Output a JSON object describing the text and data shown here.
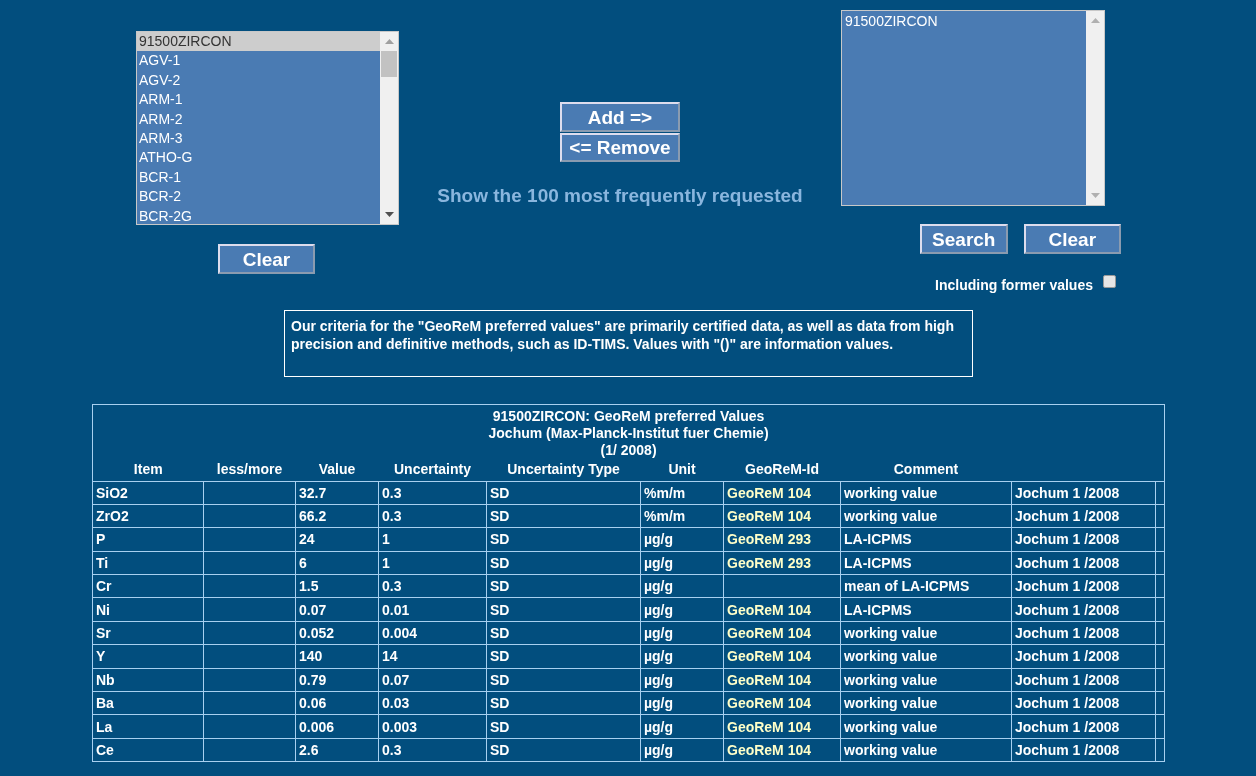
{
  "available_list": {
    "items": [
      {
        "label": "91500ZIRCON",
        "selected": true
      },
      {
        "label": "AGV-1",
        "selected": false
      },
      {
        "label": "AGV-2",
        "selected": false
      },
      {
        "label": "ARM-1",
        "selected": false
      },
      {
        "label": "ARM-2",
        "selected": false
      },
      {
        "label": "ARM-3",
        "selected": false
      },
      {
        "label": "ATHO-G",
        "selected": false
      },
      {
        "label": "BCR-1",
        "selected": false
      },
      {
        "label": "BCR-2",
        "selected": false
      },
      {
        "label": "BCR-2G",
        "selected": false
      }
    ],
    "clear_button": "Clear"
  },
  "transfer_buttons": {
    "add": "Add =>",
    "remove": "<= Remove"
  },
  "frequent_link": "Show the 100 most frequently requested",
  "chosen_list": {
    "items": [
      {
        "label": "91500ZIRCON"
      }
    ],
    "search_button": "Search",
    "clear_button": "Clear"
  },
  "former_values": {
    "label": "Including former values",
    "checked": false
  },
  "note": "Our criteria for the \"GeoReM preferred values\" are primarily certified data, as well as data from high precision and definitive methods, such as ID-TIMS. Values with \"()\" are information values.",
  "table": {
    "title_lines": [
      "91500ZIRCON: GeoReM preferred Values",
      "Jochum (Max-Planck-Institut fuer Chemie)",
      "(1/ 2008)"
    ],
    "columns": [
      "Item",
      "less/more",
      "Value",
      "Uncertainty",
      "Uncertainty Type",
      "Unit",
      "GeoReM-Id",
      "Comment"
    ],
    "rows": [
      [
        "SiO2",
        null,
        "32.7",
        "0.3",
        "SD",
        "%m/m",
        "GeoReM 104",
        "working value",
        "Jochum 1 /2008"
      ],
      [
        "ZrO2",
        null,
        "66.2",
        "0.3",
        "SD",
        "%m/m",
        "GeoReM 104",
        "working value",
        "Jochum 1 /2008"
      ],
      [
        "P",
        null,
        "24",
        "1",
        "SD",
        "µg/g",
        "GeoReM 293",
        "LA-ICPMS",
        "Jochum 1 /2008"
      ],
      [
        "Ti",
        null,
        "6",
        "1",
        "SD",
        "µg/g",
        "GeoReM 293",
        "LA-ICPMS",
        "Jochum 1 /2008"
      ],
      [
        "Cr",
        null,
        "1.5",
        "0.3",
        "SD",
        "µg/g",
        null,
        "mean of LA-ICPMS",
        "Jochum 1 /2008"
      ],
      [
        "Ni",
        null,
        "0.07",
        "0.01",
        "SD",
        "µg/g",
        "GeoReM 104",
        "LA-ICPMS",
        "Jochum 1 /2008"
      ],
      [
        "Sr",
        null,
        "0.052",
        "0.004",
        "SD",
        "µg/g",
        "GeoReM 104",
        "working value",
        "Jochum 1 /2008"
      ],
      [
        "Y",
        null,
        "140",
        "14",
        "SD",
        "µg/g",
        "GeoReM 104",
        "working value",
        "Jochum 1 /2008"
      ],
      [
        "Nb",
        null,
        "0.79",
        "0.07",
        "SD",
        "µg/g",
        "GeoReM 104",
        "working value",
        "Jochum 1 /2008"
      ],
      [
        "Ba",
        null,
        "0.06",
        "0.03",
        "SD",
        "µg/g",
        "GeoReM 104",
        "working value",
        "Jochum 1 /2008"
      ],
      [
        "La",
        null,
        "0.006",
        "0.003",
        "SD",
        "µg/g",
        "GeoReM 104",
        "working value",
        "Jochum 1 /2008"
      ],
      [
        "Ce",
        null,
        "2.6",
        "0.3",
        "SD",
        "µg/g",
        "GeoReM 104",
        "working value",
        "Jochum 1 /2008"
      ]
    ]
  }
}
